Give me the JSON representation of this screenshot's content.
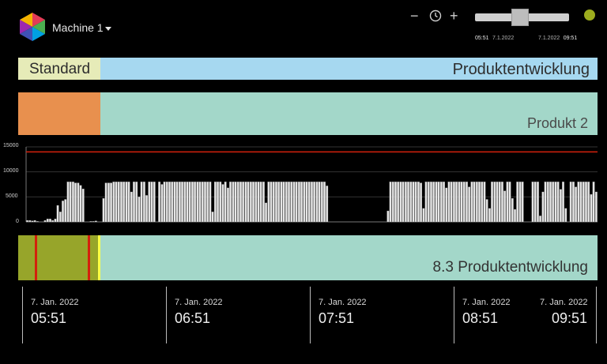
{
  "header": {
    "machine_label": "Machine 1",
    "zoom_out_symbol": "−",
    "zoom_in_symbol": "+",
    "range_start_time": "05:51",
    "range_start_date": "7.1.2022",
    "range_end_date": "7.1.2022",
    "range_end_time": "09:51",
    "slider_position": 0.5,
    "status_color": "#9cac1e"
  },
  "bands": {
    "shift_label": "Standard",
    "order_label": "Produktentwicklung",
    "product_label": "Produkt 2",
    "state_label": "8.3 Produktentwicklung"
  },
  "colors": {
    "shift": "#e6ebb8",
    "order": "#a6d8f0",
    "product_initial": "#e8904e",
    "product": "#a3d7c9",
    "state_running": "#97a52a",
    "state_marker": "#d4200c",
    "state_end_marker": "#ffff44",
    "bars": "#e6e6e6",
    "limit_line": "#d4200c"
  },
  "chart_data": {
    "type": "bar",
    "y_ticks": [
      "15000",
      "10000",
      "5000",
      "0"
    ],
    "ylim": [
      0,
      15000
    ],
    "limit": 14000,
    "values": [
      300,
      300,
      200,
      300,
      100,
      0,
      0,
      300,
      600,
      600,
      300,
      600,
      3300,
      2000,
      4200,
      4500,
      8000,
      8000,
      8000,
      7800,
      7800,
      7300,
      6600,
      0,
      0,
      100,
      100,
      200,
      0,
      0,
      4700,
      7800,
      7800,
      7800,
      8000,
      8000,
      8000,
      8000,
      8000,
      8000,
      8000,
      6000,
      8000,
      8000,
      5000,
      8000,
      8000,
      5300,
      8000,
      8000,
      8000,
      0,
      8000,
      7500,
      8000,
      8000,
      8000,
      8000,
      8000,
      8000,
      8000,
      8000,
      8000,
      8000,
      8000,
      8000,
      8000,
      8000,
      8000,
      8000,
      8000,
      8000,
      8000,
      2000,
      8000,
      8000,
      8000,
      7500,
      8000,
      6800,
      8000,
      8000,
      8000,
      8000,
      8000,
      8000,
      8000,
      8000,
      8000,
      8000,
      8000,
      8000,
      8000,
      8000,
      3800,
      8000,
      8000,
      8000,
      8000,
      8000,
      8000,
      8000,
      8000,
      8000,
      8000,
      8000,
      8000,
      8000,
      8000,
      8000,
      8000,
      8000,
      8000,
      8000,
      8000,
      8000,
      8000,
      8000,
      7200,
      0,
      0,
      0,
      0,
      0,
      0,
      0,
      0,
      0,
      0,
      0,
      0,
      0,
      0,
      0,
      0,
      0,
      0,
      0,
      0,
      0,
      0,
      0,
      2200,
      8000,
      8000,
      8000,
      8000,
      8000,
      8000,
      8000,
      8000,
      8000,
      8000,
      8000,
      8000,
      7800,
      2700,
      8000,
      8000,
      8000,
      8000,
      8000,
      8000,
      8000,
      8000,
      6800,
      8000,
      8000,
      8000,
      8000,
      8000,
      8000,
      8000,
      8000,
      7000,
      8000,
      8000,
      8000,
      8000,
      8000,
      8000,
      4500,
      2700,
      8000,
      8000,
      8000,
      8000,
      8000,
      6200,
      8000,
      8000,
      4700,
      2500,
      8000,
      8000,
      8000,
      0,
      0,
      0,
      8000,
      8000,
      8000,
      1200,
      6000,
      8000,
      8000,
      8000,
      8000,
      8000,
      8000,
      6500,
      8000,
      2700,
      0,
      8000,
      8000,
      7000,
      8000,
      8000,
      8000,
      8000,
      8000,
      5500,
      8000,
      6000
    ]
  },
  "axis": [
    {
      "date": "7. Jan. 2022",
      "time": "05:51"
    },
    {
      "date": "7. Jan. 2022",
      "time": "06:51"
    },
    {
      "date": "7. Jan. 2022",
      "time": "07:51"
    },
    {
      "date": "7. Jan. 2022",
      "time": "08:51"
    },
    {
      "date": "7. Jan. 2022",
      "time": "09:51"
    }
  ]
}
